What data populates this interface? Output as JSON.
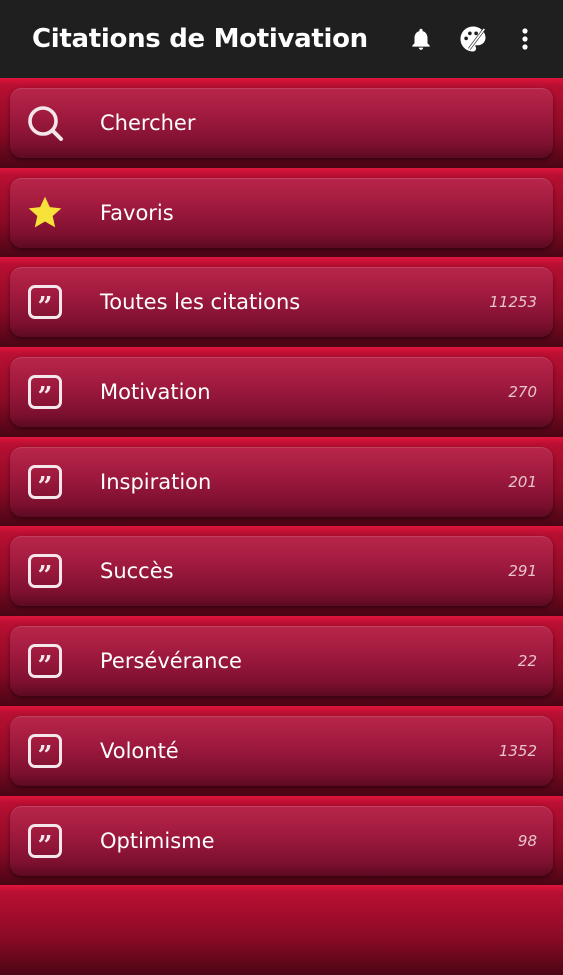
{
  "appbar": {
    "title": "Citations de Motivation",
    "icons": [
      "bell-icon",
      "palette-icon",
      "more-vert-icon"
    ]
  },
  "menu": {
    "items": [
      {
        "label": "Chercher",
        "count": "",
        "icon": "search-icon"
      },
      {
        "label": "Favoris",
        "count": "",
        "icon": "star-icon"
      },
      {
        "label": "Toutes les citations",
        "count": "11253",
        "icon": "quote-icon"
      },
      {
        "label": "Motivation",
        "count": "270",
        "icon": "quote-icon"
      },
      {
        "label": "Inspiration",
        "count": "201",
        "icon": "quote-icon"
      },
      {
        "label": "Succès",
        "count": "291",
        "icon": "quote-icon"
      },
      {
        "label": "Persévérance",
        "count": "22",
        "icon": "quote-icon"
      },
      {
        "label": "Volonté",
        "count": "1352",
        "icon": "quote-icon"
      },
      {
        "label": "Optimisme",
        "count": "98",
        "icon": "quote-icon"
      }
    ]
  },
  "colors": {
    "appbar": "#1f1f1f",
    "accent": "#c8103a",
    "card": "#a01a3e",
    "star": "#f7e23a"
  }
}
